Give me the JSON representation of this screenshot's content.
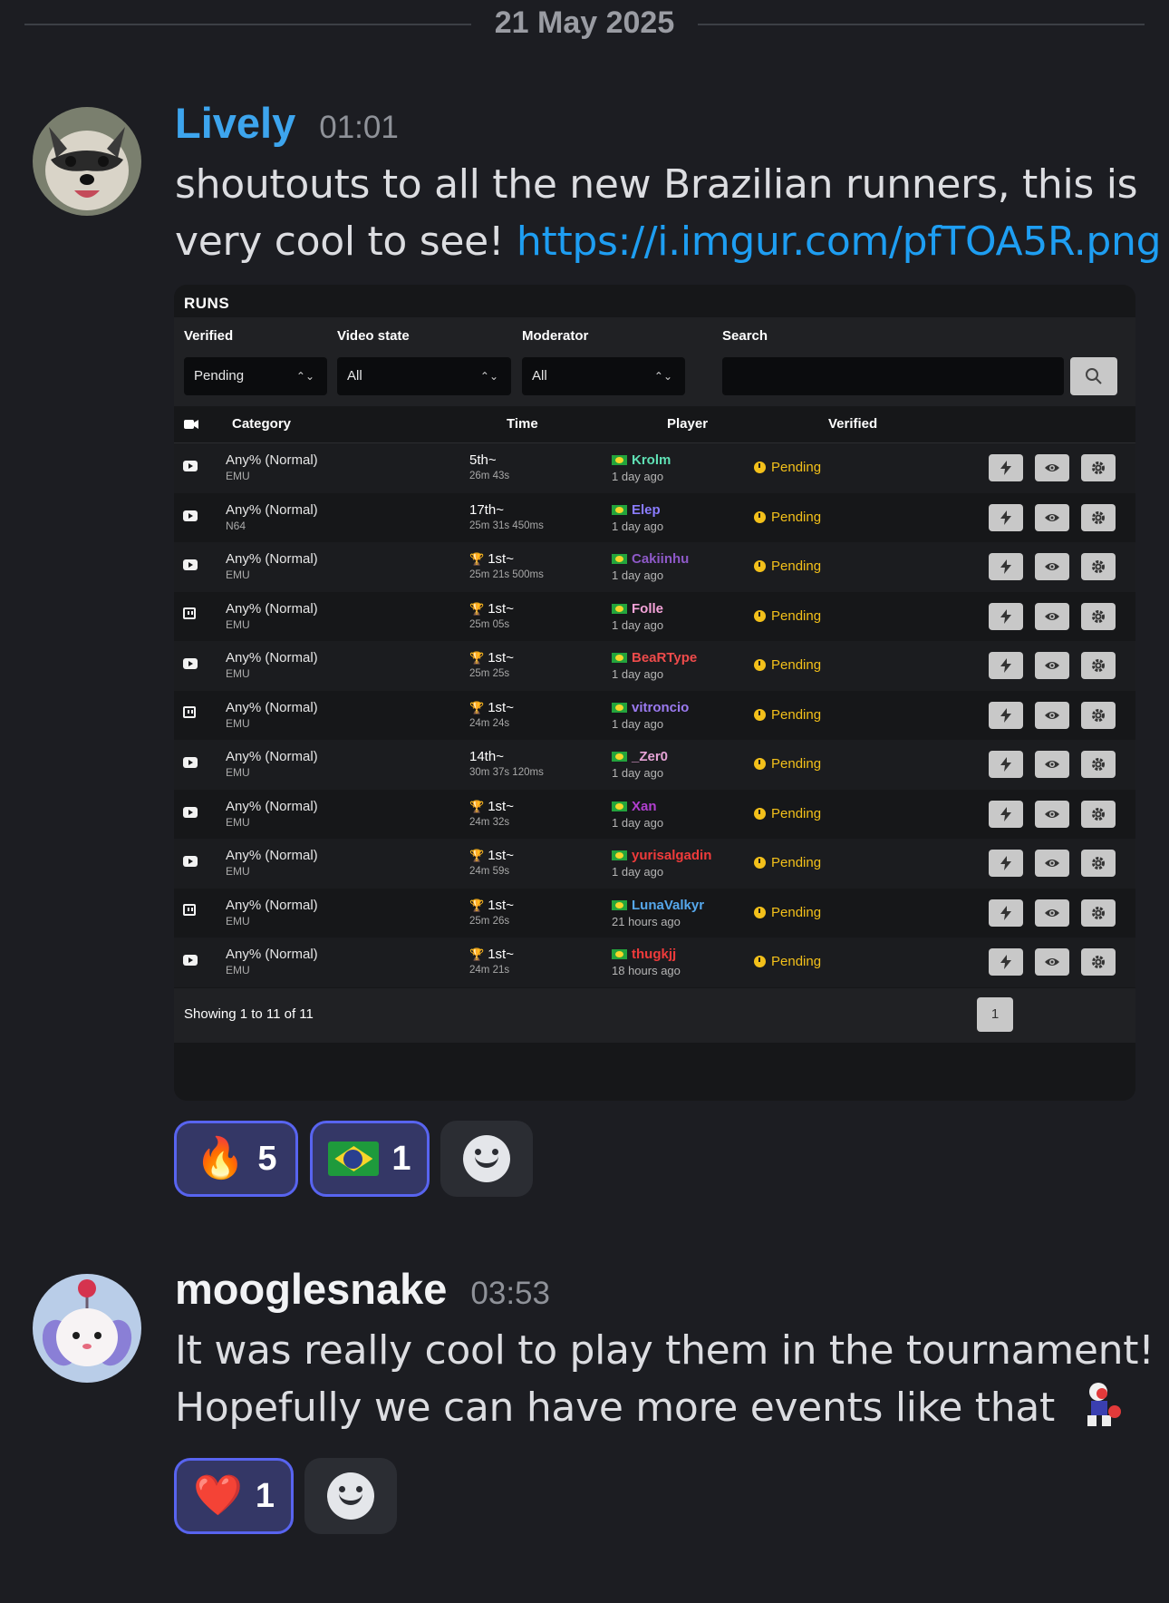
{
  "date_divider": "21 May 2025",
  "messages": [
    {
      "username": "Lively",
      "username_color": "#3da5ee",
      "time": "01:01",
      "text_line1": "shoutouts to all the new Brazilian runners, this is",
      "text_line2_prefix": "very cool to see! ",
      "link": "https://i.imgur.com/pfTOA5R.png",
      "reactions": [
        {
          "emoji": "🔥",
          "count": "5"
        },
        {
          "emoji": "brazil-flag",
          "count": "1"
        }
      ]
    },
    {
      "username": "mooglesnake",
      "username_color": "#f2f3f5",
      "time": "03:53",
      "text_line1": "It was really cool to play them in the tournament!",
      "text_line2": "Hopefully we can have more events like that",
      "reactions": [
        {
          "emoji": "❤️",
          "count": "1"
        }
      ]
    }
  ],
  "embed": {
    "title": "RUNS",
    "filters": {
      "verified_label": "Verified",
      "verified_value": "Pending",
      "video_label": "Video state",
      "video_value": "All",
      "moderator_label": "Moderator",
      "moderator_value": "All",
      "search_label": "Search",
      "search_value": ""
    },
    "columns": [
      "Category",
      "Time",
      "Player",
      "Verified"
    ],
    "rows": [
      {
        "video": "youtube",
        "category": "Any% (Normal)",
        "platform": "EMU",
        "rank": "5th~",
        "trophy": false,
        "time": "26m 43s",
        "player": "Krolm",
        "player_color": "#5fe0b4",
        "ago": "1 day ago",
        "status": "Pending"
      },
      {
        "video": "youtube",
        "category": "Any% (Normal)",
        "platform": "N64",
        "rank": "17th~",
        "trophy": false,
        "time": "25m 31s 450ms",
        "player": "Elep",
        "player_color": "#8a7cff",
        "ago": "1 day ago",
        "status": "Pending"
      },
      {
        "video": "youtube",
        "category": "Any% (Normal)",
        "platform": "EMU",
        "rank": "1st~",
        "trophy": true,
        "time": "25m 21s 500ms",
        "player": "Cakiinhu",
        "player_color": "#8e59c8",
        "ago": "1 day ago",
        "status": "Pending"
      },
      {
        "video": "twitch",
        "category": "Any% (Normal)",
        "platform": "EMU",
        "rank": "1st~",
        "trophy": true,
        "time": "25m 05s",
        "player": "Folle",
        "player_color": "#f4a3d8",
        "ago": "1 day ago",
        "status": "Pending"
      },
      {
        "video": "youtube",
        "category": "Any% (Normal)",
        "platform": "EMU",
        "rank": "1st~",
        "trophy": true,
        "time": "25m 25s",
        "player": "BeaRType",
        "player_color": "#ee4b4b",
        "ago": "1 day ago",
        "status": "Pending"
      },
      {
        "video": "twitch",
        "category": "Any% (Normal)",
        "platform": "EMU",
        "rank": "1st~",
        "trophy": true,
        "time": "24m 24s",
        "player": "vitroncio",
        "player_color": "#9b7af0",
        "ago": "1 day ago",
        "status": "Pending"
      },
      {
        "video": "youtube",
        "category": "Any% (Normal)",
        "platform": "EMU",
        "rank": "14th~",
        "trophy": false,
        "time": "30m 37s 120ms",
        "player": "_Zer0",
        "player_color": "#e6a3d6",
        "ago": "1 day ago",
        "status": "Pending"
      },
      {
        "video": "youtube",
        "category": "Any% (Normal)",
        "platform": "EMU",
        "rank": "1st~",
        "trophy": true,
        "time": "24m 32s",
        "player": "Xan",
        "player_color": "#b23fd0",
        "ago": "1 day ago",
        "status": "Pending"
      },
      {
        "video": "youtube",
        "category": "Any% (Normal)",
        "platform": "EMU",
        "rank": "1st~",
        "trophy": true,
        "time": "24m 59s",
        "player": "yurisalgadin",
        "player_color": "#ef3b3b",
        "ago": "1 day ago",
        "status": "Pending"
      },
      {
        "video": "twitch",
        "category": "Any% (Normal)",
        "platform": "EMU",
        "rank": "1st~",
        "trophy": true,
        "time": "25m 26s",
        "player": "LunaValkyr",
        "player_color": "#56a8ec",
        "ago": "21 hours ago",
        "status": "Pending"
      },
      {
        "video": "youtube",
        "category": "Any% (Normal)",
        "platform": "EMU",
        "rank": "1st~",
        "trophy": true,
        "time": "24m 21s",
        "player": "thugkjj",
        "player_color": "#ef3b3b",
        "ago": "18 hours ago",
        "status": "Pending"
      }
    ],
    "footer_text": "Showing 1 to 11 of 11",
    "page": "1"
  },
  "icons": {
    "action_buttons": [
      "lightning-icon",
      "eye-icon",
      "gear-icon"
    ],
    "status_icon": "clock-icon",
    "add_reaction_icon": "smiley-add-reaction-icon"
  }
}
